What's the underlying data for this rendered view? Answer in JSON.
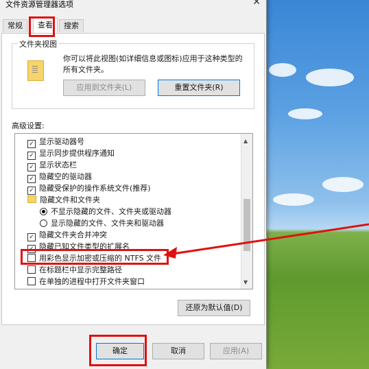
{
  "window": {
    "title": "文件资源管理器选项"
  },
  "tabs": [
    {
      "label": "常规"
    },
    {
      "label": "查看"
    },
    {
      "label": "搜索"
    }
  ],
  "folder_views": {
    "group_label": "文件夹视图",
    "description": "你可以将此视图(如详细信息或图标)应用于这种类型的所有文件夹。",
    "apply_button": "应用到文件夹(L)",
    "reset_button": "重置文件夹(R)"
  },
  "advanced": {
    "label": "高级设置:",
    "items": [
      {
        "type": "checkbox",
        "checked": true,
        "label": "显示驱动器号"
      },
      {
        "type": "checkbox",
        "checked": true,
        "label": "显示同步提供程序通知"
      },
      {
        "type": "checkbox",
        "checked": true,
        "label": "显示状态栏"
      },
      {
        "type": "checkbox",
        "checked": true,
        "label": "隐藏空的驱动器"
      },
      {
        "type": "checkbox",
        "checked": true,
        "label": "隐藏受保护的操作系统文件(推荐)"
      },
      {
        "type": "folder",
        "label": "隐藏文件和文件夹"
      },
      {
        "type": "radio",
        "checked": true,
        "label": "不显示隐藏的文件、文件夹或驱动器"
      },
      {
        "type": "radio",
        "checked": false,
        "label": "显示隐藏的文件、文件夹和驱动器"
      },
      {
        "type": "checkbox",
        "checked": true,
        "label": "隐藏文件夹合并冲突"
      },
      {
        "type": "checkbox",
        "checked": true,
        "label": "隐藏已知文件类型的扩展名"
      },
      {
        "type": "checkbox",
        "checked": false,
        "label": "用彩色显示加密或压缩的 NTFS 文件"
      },
      {
        "type": "checkbox",
        "checked": false,
        "label": "在标题栏中显示完整路径"
      },
      {
        "type": "checkbox",
        "checked": false,
        "label": "在单独的进程中打开文件夹窗口"
      }
    ],
    "restore_button": "还原为默认值(D)"
  },
  "footer": {
    "ok": "确定",
    "cancel": "取消",
    "apply": "应用(A)"
  },
  "colors": {
    "highlight": "#e01010",
    "accent": "#0078d7"
  }
}
